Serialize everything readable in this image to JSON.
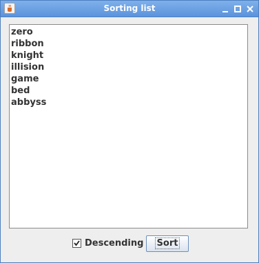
{
  "window": {
    "title": "Sorting list"
  },
  "list": {
    "items": [
      "zero",
      "ribbon",
      "knight",
      "illision",
      "game",
      "bed",
      "abbyss"
    ]
  },
  "controls": {
    "descending_label": "Descending",
    "descending_checked": true,
    "sort_label": "Sort"
  },
  "icons": {
    "app": "java-coffee-icon",
    "minimize": "minimize-icon",
    "maximize": "maximize-icon",
    "close": "close-icon"
  },
  "colors": {
    "titlebar": "#6ea3e4",
    "title_text": "#ffffff",
    "background": "#eeeeee"
  }
}
